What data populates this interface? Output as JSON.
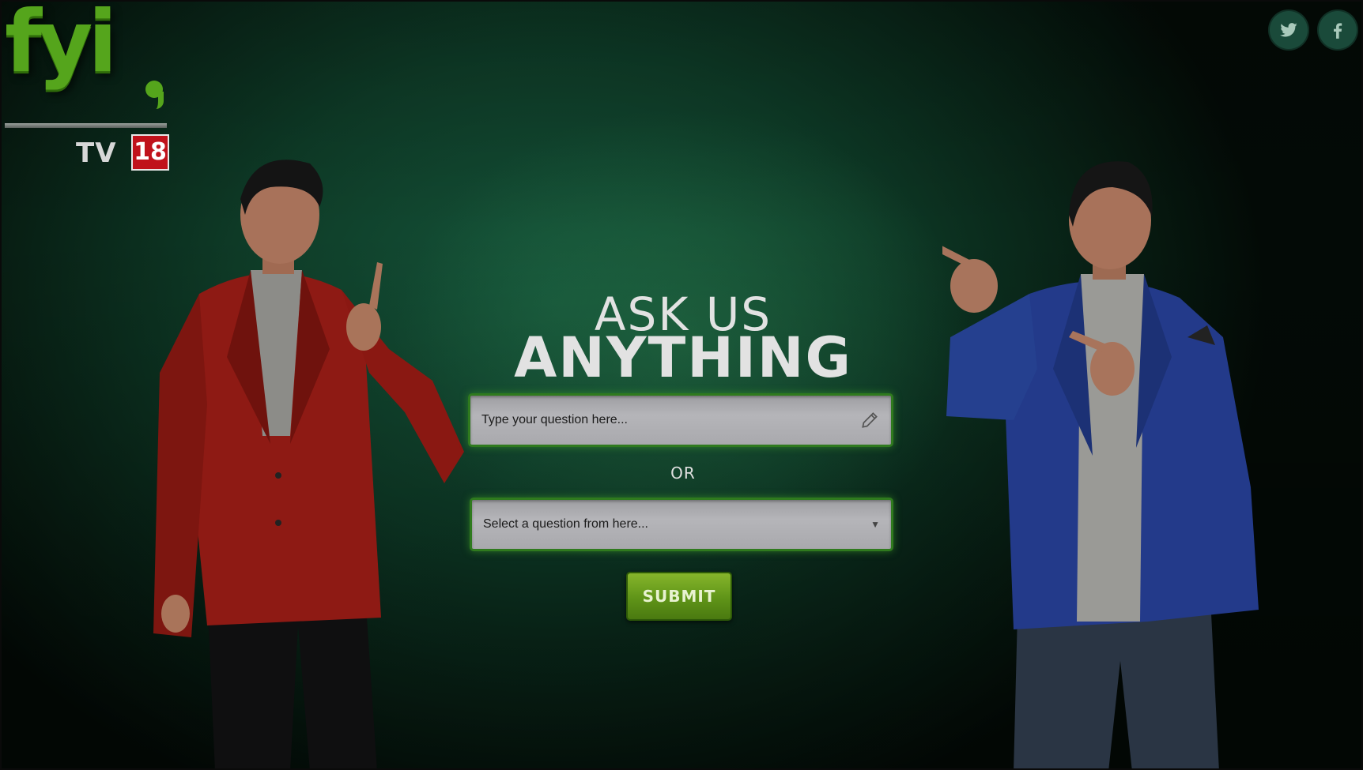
{
  "brand": {
    "logo_text": "fyi",
    "network": "TV",
    "network_number": "18"
  },
  "social": {
    "twitter_icon": "twitter-icon",
    "facebook_icon": "facebook-icon"
  },
  "hero": {
    "line1": "ASK US",
    "line2": "ANYTHING"
  },
  "form": {
    "question_placeholder": "Type your question here...",
    "or_label": "OR",
    "select_placeholder": "Select a question from here...",
    "submit_label": "SUBMIT"
  },
  "colors": {
    "brand_green": "#55a51c",
    "background": "#0e3b27",
    "submit_green": "#5f9418",
    "network_red": "#c0121b"
  }
}
